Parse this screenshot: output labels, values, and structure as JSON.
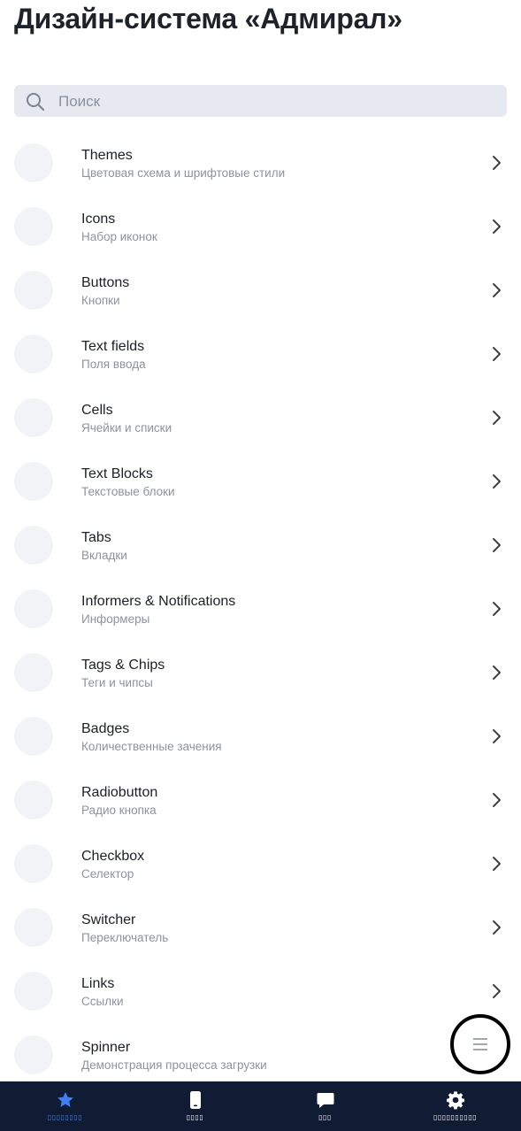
{
  "page": {
    "title": "Дизайн-система «Адмирал»"
  },
  "search": {
    "placeholder": "Поиск",
    "value": ""
  },
  "items": [
    {
      "title": "Themes",
      "subtitle": "Цветовая схема и шрифтовые стили"
    },
    {
      "title": "Icons",
      "subtitle": "Набор иконок"
    },
    {
      "title": "Buttons",
      "subtitle": "Кнопки"
    },
    {
      "title": "Text fields",
      "subtitle": "Поля ввода"
    },
    {
      "title": "Cells",
      "subtitle": "Ячейки и списки"
    },
    {
      "title": "Text Blocks",
      "subtitle": "Текстовые блоки"
    },
    {
      "title": "Tabs",
      "subtitle": "Вкладки"
    },
    {
      "title": "Informers & Notifications",
      "subtitle": "Информеры"
    },
    {
      "title": "Tags & Chips",
      "subtitle": "Теги и чипсы"
    },
    {
      "title": "Badges",
      "subtitle": "Количественные зачения"
    },
    {
      "title": "Radiobutton",
      "subtitle": "Радио кнопка"
    },
    {
      "title": "Checkbox",
      "subtitle": "Селектор"
    },
    {
      "title": "Switcher",
      "subtitle": "Переключатель"
    },
    {
      "title": "Links",
      "subtitle": "Ссылки"
    },
    {
      "title": "Spinner",
      "subtitle": "Демонстрация процесса загрузки"
    }
  ],
  "tabbar": {
    "tabs": [
      {
        "icon": "star-icon",
        "label": "▯▯▯▯▯▯▯▯",
        "active": true
      },
      {
        "icon": "phone-icon",
        "label": "▯▯▯▯",
        "active": false
      },
      {
        "icon": "chat-icon",
        "label": "▯▯▯",
        "active": false
      },
      {
        "icon": "gear-icon",
        "label": "▯▯▯▯▯▯▯▯▯▯",
        "active": false
      }
    ]
  },
  "fab": {
    "icon": "menu-lines-icon"
  },
  "colors": {
    "tabbar_bg": "#0f1c33",
    "active_tab": "#3f7ff2",
    "search_bg": "#e6eaf0",
    "subtitle": "#8c939f"
  }
}
